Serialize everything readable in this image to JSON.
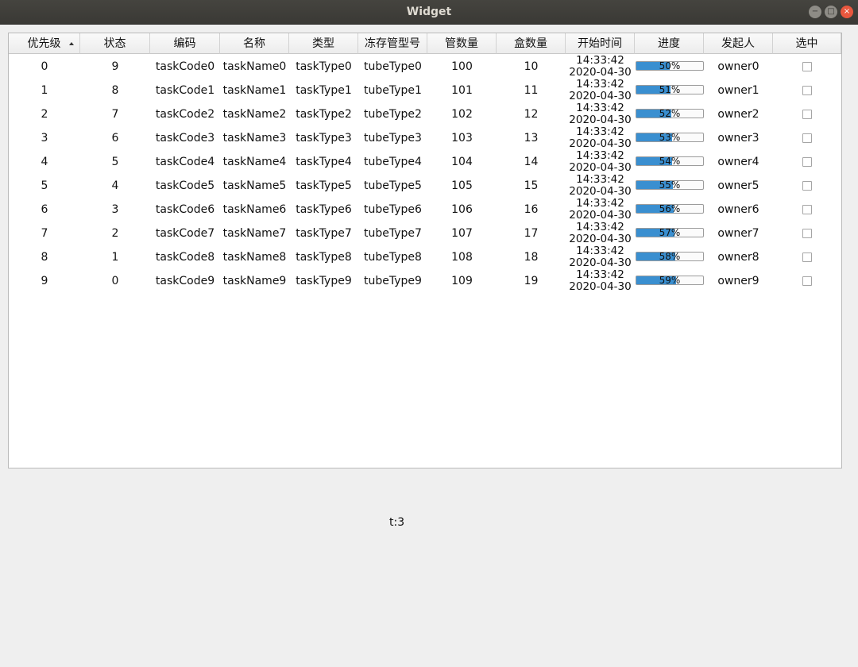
{
  "window": {
    "title": "Widget",
    "buttons": {
      "minimize": "−",
      "maximize": "□",
      "close": "×"
    }
  },
  "table": {
    "columns": [
      "优先级",
      "状态",
      "编码",
      "名称",
      "类型",
      "冻存管型号",
      "管数量",
      "盒数量",
      "开始时间",
      "进度",
      "发起人",
      "选中"
    ],
    "sort_column": "优先级",
    "sort_order": "ascending",
    "rows": [
      {
        "priority": "0",
        "status": "9",
        "code": "taskCode0",
        "name": "taskName0",
        "type": "taskType0",
        "tube_type": "tubeType0",
        "tube_count": "100",
        "box_count": "10",
        "start_time": "14:33:42",
        "start_date": "2020-04-30",
        "progress": 50,
        "progress_text": "50%",
        "owner": "owner0",
        "selected": false
      },
      {
        "priority": "1",
        "status": "8",
        "code": "taskCode1",
        "name": "taskName1",
        "type": "taskType1",
        "tube_type": "tubeType1",
        "tube_count": "101",
        "box_count": "11",
        "start_time": "14:33:42",
        "start_date": "2020-04-30",
        "progress": 51,
        "progress_text": "51%",
        "owner": "owner1",
        "selected": false
      },
      {
        "priority": "2",
        "status": "7",
        "code": "taskCode2",
        "name": "taskName2",
        "type": "taskType2",
        "tube_type": "tubeType2",
        "tube_count": "102",
        "box_count": "12",
        "start_time": "14:33:42",
        "start_date": "2020-04-30",
        "progress": 52,
        "progress_text": "52%",
        "owner": "owner2",
        "selected": false
      },
      {
        "priority": "3",
        "status": "6",
        "code": "taskCode3",
        "name": "taskName3",
        "type": "taskType3",
        "tube_type": "tubeType3",
        "tube_count": "103",
        "box_count": "13",
        "start_time": "14:33:42",
        "start_date": "2020-04-30",
        "progress": 53,
        "progress_text": "53%",
        "owner": "owner3",
        "selected": false
      },
      {
        "priority": "4",
        "status": "5",
        "code": "taskCode4",
        "name": "taskName4",
        "type": "taskType4",
        "tube_type": "tubeType4",
        "tube_count": "104",
        "box_count": "14",
        "start_time": "14:33:42",
        "start_date": "2020-04-30",
        "progress": 54,
        "progress_text": "54%",
        "owner": "owner4",
        "selected": false
      },
      {
        "priority": "5",
        "status": "4",
        "code": "taskCode5",
        "name": "taskName5",
        "type": "taskType5",
        "tube_type": "tubeType5",
        "tube_count": "105",
        "box_count": "15",
        "start_time": "14:33:42",
        "start_date": "2020-04-30",
        "progress": 55,
        "progress_text": "55%",
        "owner": "owner5",
        "selected": false
      },
      {
        "priority": "6",
        "status": "3",
        "code": "taskCode6",
        "name": "taskName6",
        "type": "taskType6",
        "tube_type": "tubeType6",
        "tube_count": "106",
        "box_count": "16",
        "start_time": "14:33:42",
        "start_date": "2020-04-30",
        "progress": 56,
        "progress_text": "56%",
        "owner": "owner6",
        "selected": false
      },
      {
        "priority": "7",
        "status": "2",
        "code": "taskCode7",
        "name": "taskName7",
        "type": "taskType7",
        "tube_type": "tubeType7",
        "tube_count": "107",
        "box_count": "17",
        "start_time": "14:33:42",
        "start_date": "2020-04-30",
        "progress": 57,
        "progress_text": "57%",
        "owner": "owner7",
        "selected": false
      },
      {
        "priority": "8",
        "status": "1",
        "code": "taskCode8",
        "name": "taskName8",
        "type": "taskType8",
        "tube_type": "tubeType8",
        "tube_count": "108",
        "box_count": "18",
        "start_time": "14:33:42",
        "start_date": "2020-04-30",
        "progress": 58,
        "progress_text": "58%",
        "owner": "owner8",
        "selected": false
      },
      {
        "priority": "9",
        "status": "0",
        "code": "taskCode9",
        "name": "taskName9",
        "type": "taskType9",
        "tube_type": "tubeType9",
        "tube_count": "109",
        "box_count": "19",
        "start_time": "14:33:42",
        "start_date": "2020-04-30",
        "progress": 59,
        "progress_text": "59%",
        "owner": "owner9",
        "selected": false
      }
    ]
  },
  "status_label": "t:3",
  "colors": {
    "progress_fill": "#3a8fd0",
    "titlebar": "#3d3c38",
    "close_button": "#e9573e",
    "background": "#efefef"
  }
}
